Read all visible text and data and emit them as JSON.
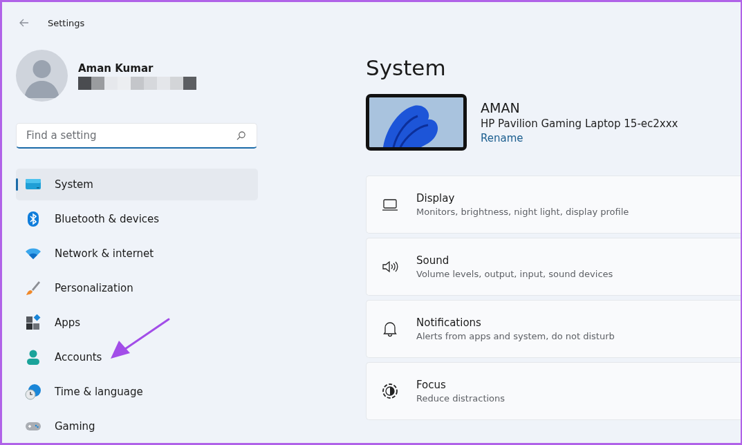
{
  "window": {
    "title": "Settings"
  },
  "account": {
    "name": "Aman Kumar"
  },
  "search": {
    "placeholder": "Find a setting"
  },
  "nav": [
    {
      "label": "System",
      "selected": true
    },
    {
      "label": "Bluetooth & devices",
      "selected": false
    },
    {
      "label": "Network & internet",
      "selected": false
    },
    {
      "label": "Personalization",
      "selected": false
    },
    {
      "label": "Apps",
      "selected": false
    },
    {
      "label": "Accounts",
      "selected": false
    },
    {
      "label": "Time & language",
      "selected": false
    },
    {
      "label": "Gaming",
      "selected": false
    }
  ],
  "page": {
    "title": "System"
  },
  "device": {
    "name": "AMAN",
    "model": "HP Pavilion Gaming Laptop 15-ec2xxx",
    "rename": "Rename"
  },
  "cards": [
    {
      "title": "Display",
      "subtitle": "Monitors, brightness, night light, display profile"
    },
    {
      "title": "Sound",
      "subtitle": "Volume levels, output, input, sound devices"
    },
    {
      "title": "Notifications",
      "subtitle": "Alerts from apps and system, do not disturb"
    },
    {
      "title": "Focus",
      "subtitle": "Reduce distractions"
    }
  ]
}
